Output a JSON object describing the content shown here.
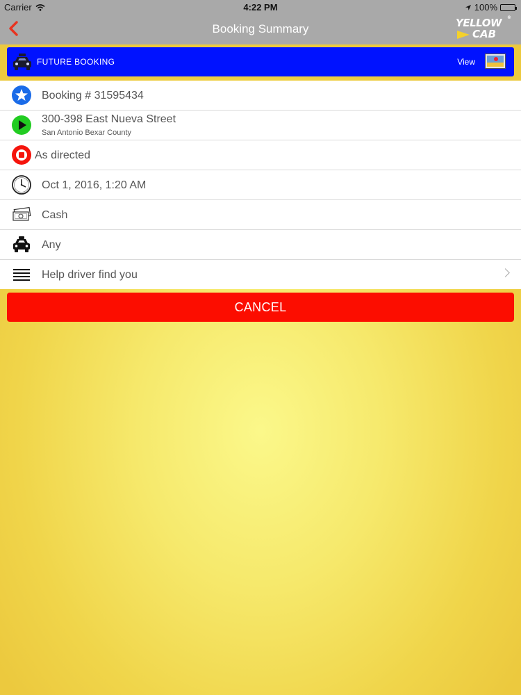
{
  "status_bar": {
    "carrier": "Carrier",
    "time": "4:22 PM",
    "battery": "100%"
  },
  "nav": {
    "title": "Booking Summary",
    "logo_line1": "YELLOW",
    "logo_line2": "CAB",
    "logo_reg": "®"
  },
  "banner": {
    "label": "FUTURE BOOKING",
    "view_label": "View",
    "background_color": "#0012ff"
  },
  "details": {
    "booking": "Booking # 31595434",
    "pickup_street": "300-398 East Nueva Street",
    "pickup_area": "San Antonio Bexar County",
    "destination": "As directed",
    "datetime": "Oct 1, 2016, 1:20 AM",
    "payment": "Cash",
    "vehicle": "Any",
    "help": "Help driver find you"
  },
  "actions": {
    "cancel_label": "CANCEL",
    "cancel_color": "#fc0d00"
  },
  "icons": {
    "booking": "star-icon",
    "pickup": "play-icon",
    "destination": "stop-icon",
    "datetime": "clock-icon",
    "payment": "cash-icon",
    "vehicle": "taxi-icon",
    "help": "menu-lines-icon"
  }
}
